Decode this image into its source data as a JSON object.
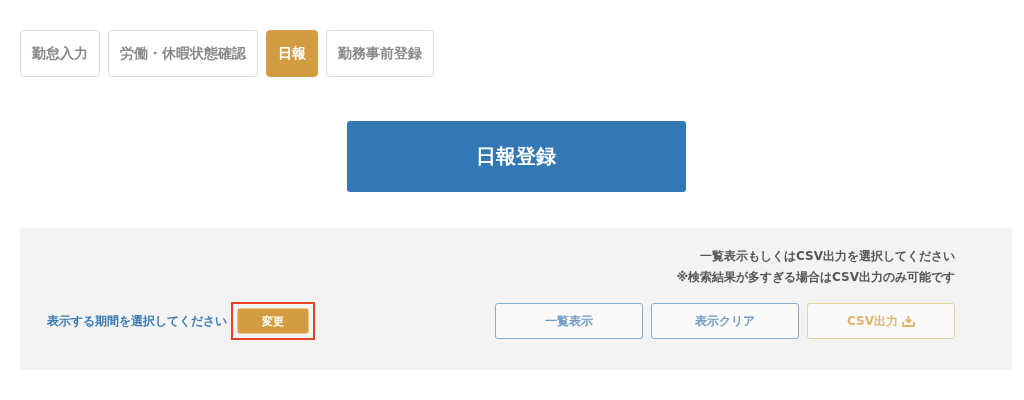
{
  "tabs": [
    {
      "label": "勤怠入力",
      "selected": false
    },
    {
      "label": "労働・休暇状態確認",
      "selected": false
    },
    {
      "label": "日報",
      "selected": true
    },
    {
      "label": "勤務事前登録",
      "selected": false
    }
  ],
  "primary_button": {
    "label": "日報登録"
  },
  "filter_panel": {
    "instructions": [
      "一覧表示もしくはCSV出力を選択してください",
      "※検索結果が多すぎる場合はCSV出力のみ可能です"
    ],
    "period_label": "表示する期間を選択してください",
    "change_button": {
      "label": "変更",
      "highlighted": true
    },
    "actions": [
      {
        "label": "一覧表示",
        "kind": "normal",
        "disabled": false
      },
      {
        "label": "表示クリア",
        "kind": "normal",
        "disabled": false
      },
      {
        "label": "CSV出力",
        "kind": "download",
        "disabled": true
      }
    ]
  }
}
